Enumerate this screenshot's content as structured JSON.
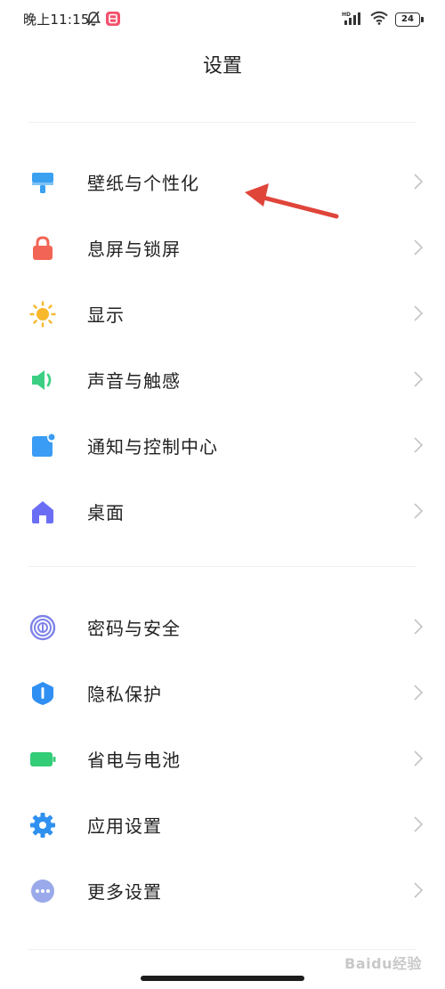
{
  "status_bar": {
    "time": "晚上11:15",
    "battery": "24",
    "network": "HD"
  },
  "page": {
    "title": "设置"
  },
  "colors": {
    "wallpaper": "#3aa0f0",
    "lockscreen": "#f26455",
    "display": "#f7b82b",
    "sound": "#3ccf83",
    "notification": "#3b9cf5",
    "desktop": "#6b6ef5",
    "security": "#7d83e8",
    "privacy": "#2f8ff2",
    "battery": "#33cc77",
    "apps": "#2f90ef",
    "more": "#9aa9ea",
    "annotation_arrow": "#e0453a"
  },
  "sections": [
    {
      "items": [
        {
          "label": "壁纸与个性化",
          "icon": "wallpaper-brush-icon"
        },
        {
          "label": "息屏与锁屏",
          "icon": "lock-icon"
        },
        {
          "label": "显示",
          "icon": "sun-icon"
        },
        {
          "label": "声音与触感",
          "icon": "speaker-icon"
        },
        {
          "label": "通知与控制中心",
          "icon": "notification-icon"
        },
        {
          "label": "桌面",
          "icon": "home-icon"
        }
      ]
    },
    {
      "items": [
        {
          "label": "密码与安全",
          "icon": "fingerprint-icon"
        },
        {
          "label": "隐私保护",
          "icon": "privacy-shield-icon"
        },
        {
          "label": "省电与电池",
          "icon": "battery-icon"
        },
        {
          "label": "应用设置",
          "icon": "gear-icon"
        },
        {
          "label": "更多设置",
          "icon": "more-icon"
        }
      ]
    }
  ],
  "watermark": {
    "text": "Baidu经验"
  }
}
